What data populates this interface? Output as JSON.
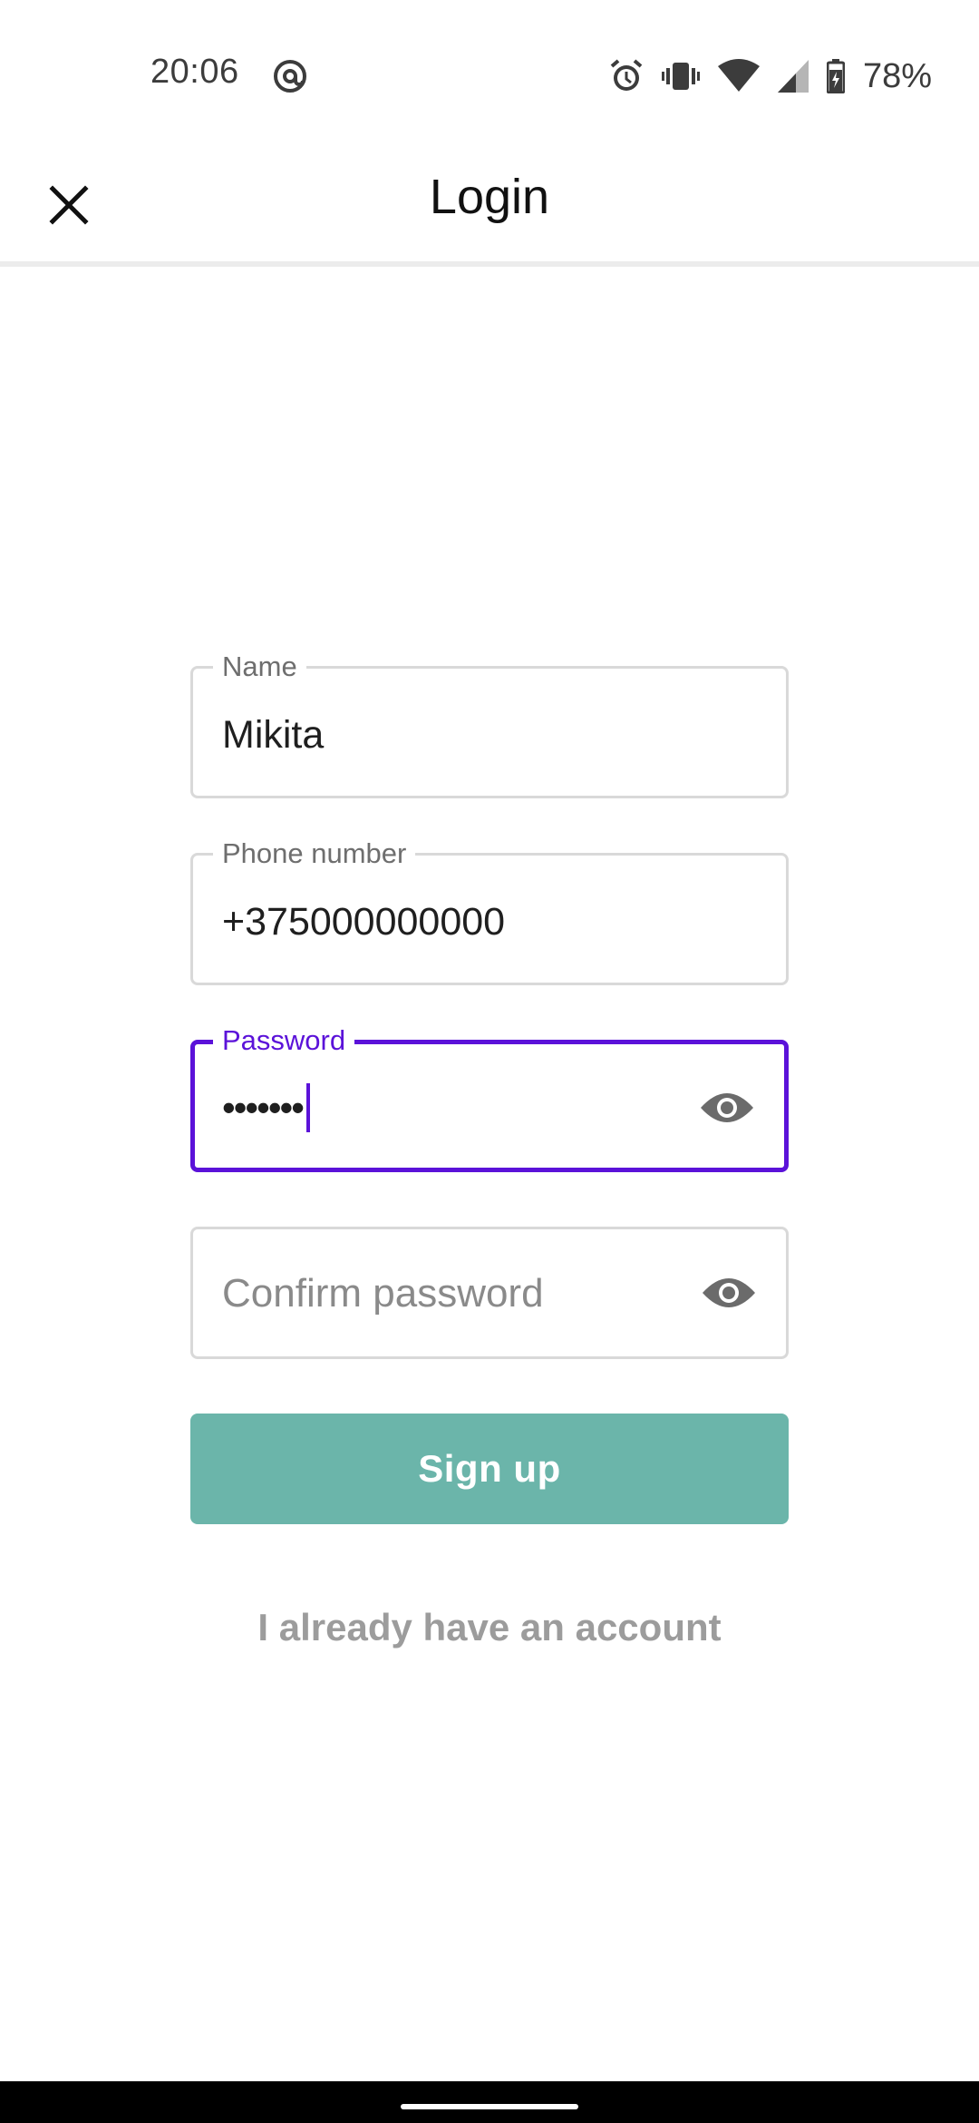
{
  "status_bar": {
    "time": "20:06",
    "battery_percent": "78%",
    "icons": [
      "at-sign-icon",
      "alarm-icon",
      "vibrate-icon",
      "wifi-icon",
      "signal-icon",
      "battery-icon"
    ]
  },
  "app_bar": {
    "title": "Login",
    "close_icon": "close-icon"
  },
  "form": {
    "name": {
      "label": "Name",
      "value": "Mikita"
    },
    "phone": {
      "label": "Phone number",
      "value": "+375000000000"
    },
    "password": {
      "label": "Password",
      "masked_value": "•••••••",
      "focused": true
    },
    "confirm_password": {
      "placeholder": "Confirm password"
    },
    "signup_label": "Sign up",
    "login_link_label": "I already have an account"
  },
  "colors": {
    "focus_accent": "#5b12d9",
    "signup_button": "#6bb5aa",
    "link_text": "#9c9c9c"
  }
}
